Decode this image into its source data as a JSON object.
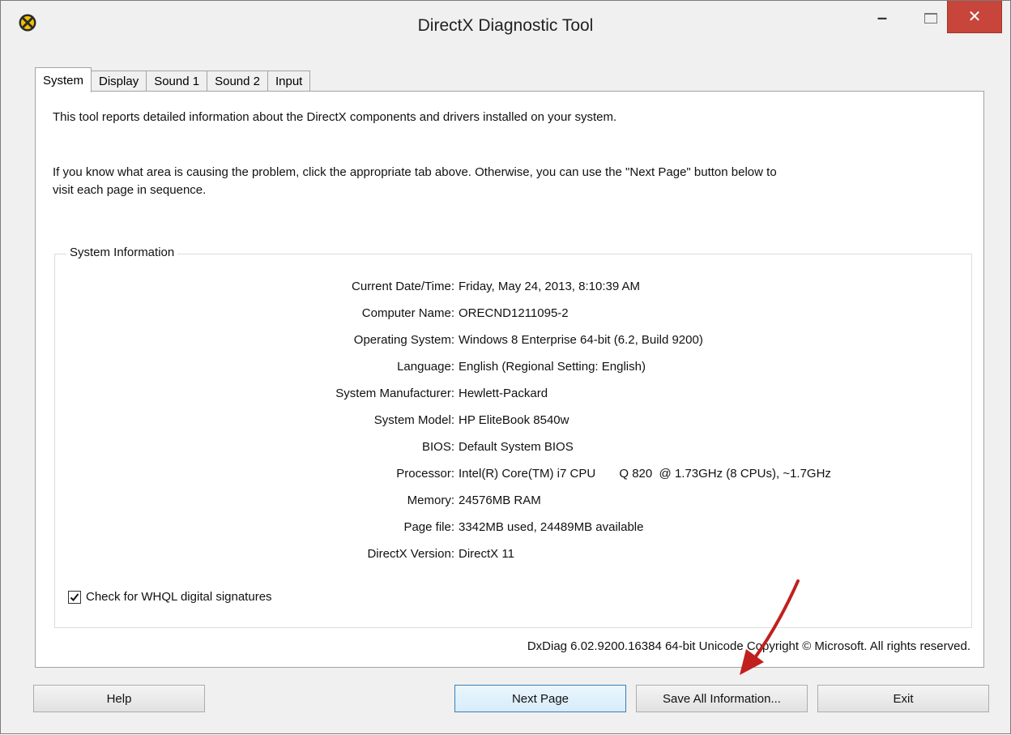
{
  "window": {
    "title": "DirectX Diagnostic Tool",
    "minimize_glyph": "–",
    "close_glyph": "✕"
  },
  "tabs": [
    {
      "label": "System",
      "active": true
    },
    {
      "label": "Display",
      "active": false
    },
    {
      "label": "Sound 1",
      "active": false
    },
    {
      "label": "Sound 2",
      "active": false
    },
    {
      "label": "Input",
      "active": false
    }
  ],
  "intro": {
    "line1": "This tool reports detailed information about the DirectX components and drivers installed on your system.",
    "line2a": "If you know what area is causing the problem, click the appropriate tab above.  Otherwise, you can use the \"Next Page\" button below to",
    "line2b": "visit each page in sequence."
  },
  "system_info": {
    "legend": "System Information",
    "rows": [
      {
        "label": "Current Date/Time:",
        "value": "Friday, May 24, 2013, 8:10:39 AM"
      },
      {
        "label": "Computer Name:",
        "value": "ORECND1211095-2"
      },
      {
        "label": "Operating System:",
        "value": "Windows 8 Enterprise 64-bit (6.2, Build 9200)"
      },
      {
        "label": "Language:",
        "value": "English (Regional Setting: English)"
      },
      {
        "label": "System Manufacturer:",
        "value": "Hewlett-Packard"
      },
      {
        "label": "System Model:",
        "value": "HP EliteBook 8540w"
      },
      {
        "label": "BIOS:",
        "value": "Default System BIOS"
      },
      {
        "label": "Processor:",
        "value": "Intel(R) Core(TM) i7 CPU       Q 820  @ 1.73GHz (8 CPUs), ~1.7GHz"
      },
      {
        "label": "Memory:",
        "value": "24576MB RAM"
      },
      {
        "label": "Page file:",
        "value": "3342MB used, 24489MB available"
      },
      {
        "label": "DirectX Version:",
        "value": "DirectX 11"
      }
    ],
    "whql_label": "Check for WHQL digital signatures",
    "whql_checked": true
  },
  "footer": {
    "copyright": "DxDiag 6.02.9200.16384 64-bit Unicode  Copyright © Microsoft. All rights reserved."
  },
  "buttons": {
    "help": "Help",
    "next_page": "Next Page",
    "save_all": "Save All Information...",
    "exit": "Exit"
  },
  "colors": {
    "close_button": "#c7453a",
    "annotation_arrow": "#c0201e"
  }
}
